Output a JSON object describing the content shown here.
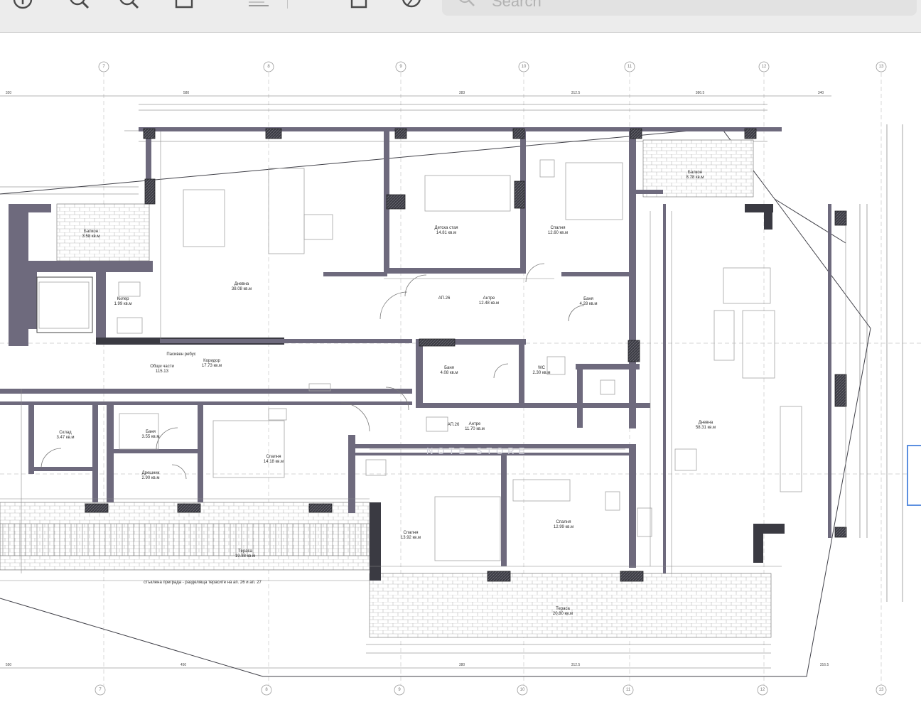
{
  "toolbar": {
    "buttons": [
      {
        "name": "info-button",
        "icon": "info-circle-icon"
      },
      {
        "name": "zoom-out-button",
        "icon": "zoom-out-icon"
      },
      {
        "name": "zoom-in-button",
        "icon": "zoom-in-icon"
      },
      {
        "name": "share-button",
        "icon": "share-icon"
      },
      {
        "name": "markup-button",
        "icon": "pen-icon"
      },
      {
        "name": "rotate-button",
        "icon": "rotate-icon"
      },
      {
        "name": "annotate-button",
        "icon": "pencil-circle-icon"
      }
    ],
    "search": {
      "placeholder": "Search",
      "value": ""
    }
  },
  "plan": {
    "grid_axes_top": [
      "7",
      "8",
      "9",
      "10",
      "11",
      "12",
      "13"
    ],
    "grid_axes_bottom": [
      "7",
      "8",
      "9",
      "10",
      "11",
      "12",
      "13"
    ],
    "rooms": {
      "living_left": {
        "name": "Дневна",
        "area": "38.08 кв.м"
      },
      "balcony_left": {
        "name": "Балкон",
        "area": "3.58 кв.м"
      },
      "wc": {
        "name": "Килер",
        "area": "1.99 кв.м"
      },
      "child_room": {
        "name": "Детска стая",
        "area": "14.81 кв.м"
      },
      "bedroom_top": {
        "name": "Спалня",
        "area": "12.60 кв.м"
      },
      "bath_top": {
        "name": "Баня",
        "area": "4.28 кв.м"
      },
      "hall_top": {
        "name": "Антре",
        "area": "12.48 кв.м"
      },
      "balcony_right": {
        "name": "Балкон",
        "area": "8.78 кв.м"
      },
      "corridor": {
        "name": "Коридор",
        "area": "17.73 кв.м"
      },
      "common": {
        "name": "Общи части",
        "area": "115.13"
      },
      "bath_mid": {
        "name": "Баня",
        "area": "4.08 кв.м"
      },
      "wc_mid": {
        "name": "WC",
        "area": "2.30 кв.м"
      },
      "living_right": {
        "name": "Дневна",
        "area": "58.31 кв.м"
      },
      "storage": {
        "name": "Склад",
        "area": "3.47 кв.м"
      },
      "bath_bottom": {
        "name": "Баня",
        "area": "3.55 кв.м"
      },
      "dressing": {
        "name": "Дрешник",
        "area": "2.90 кв.м"
      },
      "bedroom_bottom_left": {
        "name": "Спалня",
        "area": "14.18 кв.м"
      },
      "hall_bottom": {
        "name": "Антре",
        "area": "11.70 кв.м"
      },
      "bedroom_bottom_mid": {
        "name": "Спалня",
        "area": "13.92 кв.м"
      },
      "bedroom_bottom_right": {
        "name": "Спалня",
        "area": "12.99 кв.м"
      },
      "terrace_left": {
        "name": "Тераса",
        "area": "19.38 кв.м"
      },
      "terrace_bottom": {
        "name": "Тераса",
        "area": "20.80 кв.м"
      }
    },
    "notes": {
      "parapet": "стъклена преграда - разделяща терасите на ап. 26 и ап. 27",
      "elevator": "Пасивен ребус",
      "ap_left": "АП.26",
      "ap_right": "АП.26"
    },
    "dimensions_top": [
      "320",
      "580",
      "383",
      "312.5",
      "386.5",
      "340"
    ],
    "dimensions_bottom": [
      "550",
      "450",
      "380",
      "312.5",
      "316.5"
    ],
    "watermark": "NOTE STORE"
  }
}
